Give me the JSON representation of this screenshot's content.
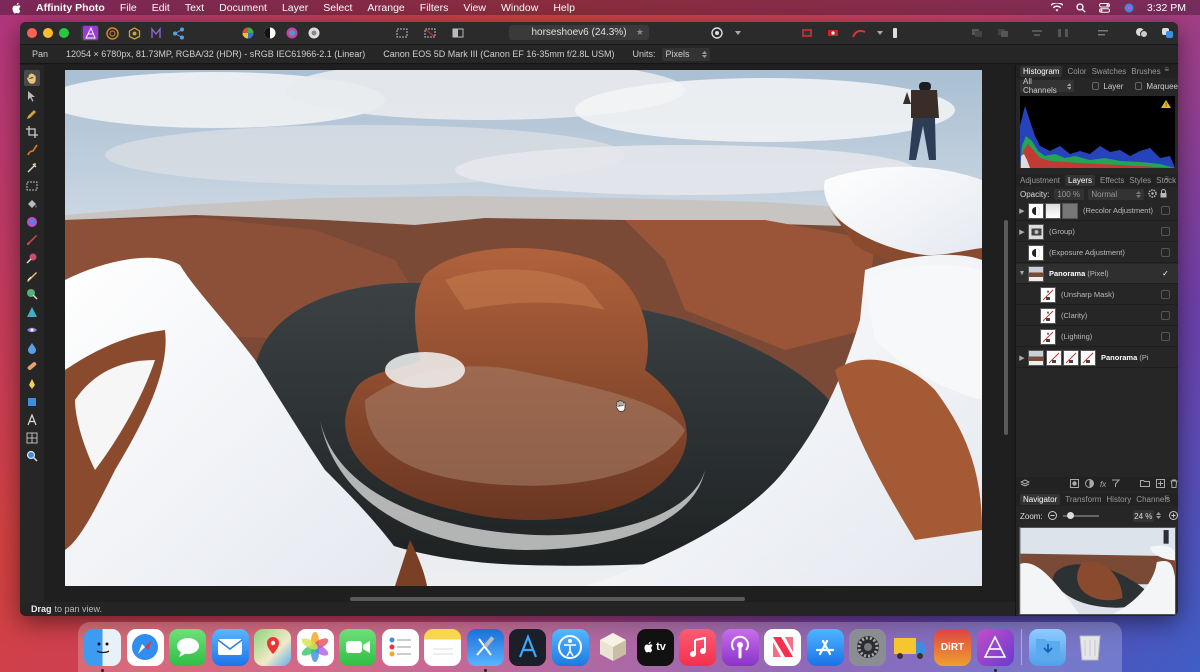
{
  "menubar": {
    "app_name": "Affinity Photo",
    "items": [
      "File",
      "Edit",
      "Text",
      "Document",
      "Layer",
      "Select",
      "Arrange",
      "Filters",
      "View",
      "Window",
      "Help"
    ],
    "clock": "3:32 PM"
  },
  "document": {
    "title": "horseshoev6 (24.3%)"
  },
  "context_toolbar": {
    "tool_name": "Pan",
    "image_info": "12054 × 6780px, 81.73MP, RGBA/32 (HDR) - sRGB IEC61966-2.1 (Linear)",
    "camera_info": "Canon EOS 5D Mark III (Canon EF 16-35mm f/2.8L USM)",
    "units_label": "Units:",
    "units_value": "Pixels"
  },
  "status_bar": {
    "action": "Drag",
    "hint": "to pan view."
  },
  "histogram_panel": {
    "tabs": [
      "Histogram",
      "Color",
      "Swatches",
      "Brushes"
    ],
    "active_tab": "Histogram",
    "channel_select": "All Channels",
    "layer_label": "Layer",
    "marquee_label": "Marquee"
  },
  "layers_panel": {
    "tabs": [
      "Adjustment",
      "Layers",
      "Effects",
      "Styles",
      "Stock"
    ],
    "active_tab": "Layers",
    "opacity_label": "Opacity:",
    "opacity_value": "100 %",
    "blend_mode": "Normal",
    "layers": [
      {
        "name": "(Recolor Adjustment)",
        "bold": "",
        "arrow": "▶",
        "indent": false,
        "checked": false
      },
      {
        "name": "(Group)",
        "bold": "",
        "arrow": "▶",
        "indent": false,
        "checked": false
      },
      {
        "name": "(Exposure Adjustment)",
        "bold": "",
        "arrow": "",
        "indent": false,
        "checked": false
      },
      {
        "name": " (Pixel)",
        "bold": "Panorama",
        "arrow": "▼",
        "indent": false,
        "checked": true
      },
      {
        "name": "(Unsharp Mask)",
        "bold": "",
        "arrow": "",
        "indent": true,
        "checked": false
      },
      {
        "name": "(Clarity)",
        "bold": "",
        "arrow": "",
        "indent": true,
        "checked": false
      },
      {
        "name": "(Lighting)",
        "bold": "",
        "arrow": "",
        "indent": true,
        "checked": false
      },
      {
        "name": " (Pi",
        "bold": "Panorama",
        "arrow": "▶",
        "indent": false,
        "checked": false
      }
    ]
  },
  "navigator_panel": {
    "tabs": [
      "Navigator",
      "Transform",
      "History",
      "Channels"
    ],
    "active_tab": "Navigator",
    "zoom_label": "Zoom:",
    "zoom_value": "24 %"
  },
  "dock": {
    "apps": [
      "Finder",
      "Safari",
      "Messages",
      "Mail",
      "Maps",
      "Photos",
      "FaceTime",
      "Reminders",
      "Notes",
      "Xcode",
      "Instruments",
      "Accessibility Inspector",
      "Reality Composer",
      "Apple TV",
      "Music",
      "Podcasts",
      "News",
      "App Store",
      "System Preferences",
      "Transmit",
      "DiRT Rally",
      "Affinity Photo"
    ],
    "dirt_label": "DiRT",
    "tv_label": "tv"
  },
  "colors": {
    "app_accent": "#9b3bd6",
    "panel_bg": "#262626",
    "window_bg": "#1e1e1e"
  }
}
